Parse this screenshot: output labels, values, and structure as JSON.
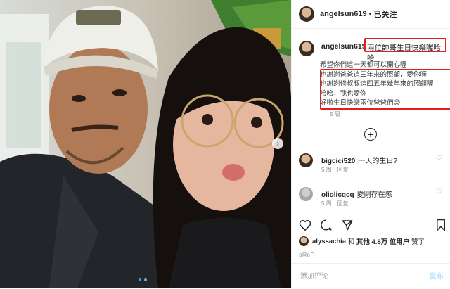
{
  "header": {
    "username": "angelsun619",
    "separator": "•",
    "follow_status": "已关注"
  },
  "caption": {
    "username": "angelsun619",
    "title": "兩位帥哥生日快樂喔哈哈",
    "lines": [
      "希望你們這一天都可以開心喔",
      "也謝謝爸爸這三年來的照顧，愛你喔",
      "也謝謝修叔叔這四五年幾年來的照顧喔",
      "哈哈，我也愛你",
      "好啦生日快樂兩位爸爸們😊"
    ],
    "time": "5 周"
  },
  "comments": [
    {
      "username": "bigcici520",
      "text": "一天的生日?",
      "time": "5 周",
      "reply_label": "回复"
    },
    {
      "username": "oliolicqcq",
      "text": "愛剛存在感",
      "time": "5 周",
      "reply_label": "回复"
    }
  ],
  "likes": {
    "username": "alyssachia",
    "and_label": "和",
    "others_label": "其他 4.8万 位用户",
    "liked_label": "赞了"
  },
  "date": "3月6日",
  "add_comment": {
    "placeholder": "添加评论...",
    "publish_label": "发布"
  },
  "icons": {
    "heart": "heart-icon",
    "comment": "comment-icon",
    "share": "share-icon",
    "bookmark": "bookmark-icon",
    "plus": "plus-circle-icon",
    "carousel": "chevron-right-icon"
  },
  "carousel": {
    "current_slide": 1,
    "total_slides": 2
  },
  "colors": {
    "highlight_box": "#e02020",
    "link_blue": "#3897f0",
    "publish_disabled": "#b2dffc"
  }
}
